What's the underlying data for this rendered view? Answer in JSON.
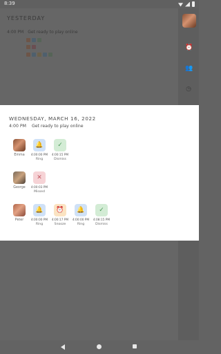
{
  "status_bar": {
    "time": "8:39"
  },
  "background": {
    "section_header": "YESTERDAY",
    "entry_time": "4:00 PM",
    "entry_message": "Get ready to play online"
  },
  "sheet": {
    "date_header": "WEDNESDAY, MARCH 16, 2022",
    "time": "4:00 PM",
    "message": "Get ready to play online",
    "people": [
      {
        "name": "Emma",
        "events": [
          {
            "time": "4:00:00 PM",
            "label": "Ring",
            "kind": "ring",
            "icon": "bell-icon"
          },
          {
            "time": "4:00:15 PM",
            "label": "Dismiss",
            "kind": "dismiss",
            "icon": "check-icon"
          }
        ]
      },
      {
        "name": "George",
        "events": [
          {
            "time": "4:00:03 PM",
            "label": "Missed",
            "kind": "missed",
            "icon": "close-icon"
          }
        ]
      },
      {
        "name": "Peter",
        "events": [
          {
            "time": "4:00:00 PM",
            "label": "Ring",
            "kind": "ring",
            "icon": "bell-icon"
          },
          {
            "time": "4:00:17 PM",
            "label": "Snooze",
            "kind": "snooze",
            "icon": "alarm-clock-icon"
          },
          {
            "time": "4:00:00 PM",
            "label": "Ring",
            "kind": "ring",
            "icon": "bell-icon"
          },
          {
            "time": "4:08:15 PM",
            "label": "Dismiss",
            "kind": "dismiss",
            "icon": "check-icon"
          }
        ]
      }
    ]
  },
  "colors": {
    "scrim": "#636363",
    "ring_tile": "#cfe1f7",
    "dismiss_tile": "#d3ecd5",
    "missed_tile": "#f6d3d6",
    "snooze_tile": "#fbe3c2"
  }
}
